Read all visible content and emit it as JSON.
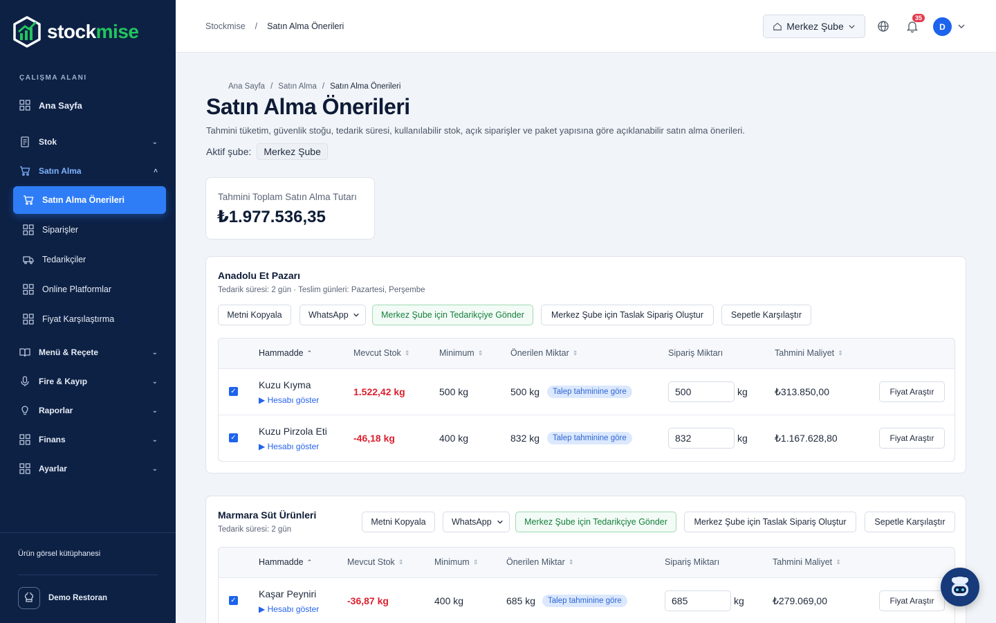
{
  "brand": {
    "name_a": "stock",
    "name_b": "mise"
  },
  "sidebar": {
    "workspace_label": "ÇALIŞMA ALANI",
    "home": "Ana Sayfa",
    "stock": "Stok",
    "purchasing": "Satın Alma",
    "sub": {
      "suggestions": "Satın Alma Önerileri",
      "orders": "Siparişler",
      "suppliers": "Tedarikçiler",
      "platforms": "Online Platformlar",
      "price_compare": "Fiyat Karşılaştırma"
    },
    "menu_recipe": "Menü & Reçete",
    "waste": "Fire & Kayıp",
    "reports": "Raporlar",
    "finance": "Finans",
    "settings": "Ayarlar",
    "image_library": "Ürün görsel kütüphanesi",
    "restaurant": "Demo Restoran"
  },
  "topbar": {
    "crumb_root": "Stockmise",
    "crumb_sep": "/",
    "crumb_current": "Satın Alma Önerileri",
    "branch": "Merkez Şube",
    "notifications": "35",
    "avatar": "D"
  },
  "page": {
    "crumbs": [
      "Ana Sayfa",
      "/",
      "Satın Alma",
      "/",
      "Satın Alma Önerileri"
    ],
    "title": "Satın Alma Önerileri",
    "description": "Tahmini tüketim, güvenlik stoğu, tedarik süresi, kullanılabilir stok, açık siparişler ve paket yapısına göre açıklanabilir satın alma önerileri.",
    "active_branch_label": "Aktif şube:",
    "active_branch": "Merkez Şube",
    "total_label": "Tahmini Toplam Satın Alma Tutarı",
    "total_value": "₺1.977.536,35"
  },
  "actions": {
    "copy": "Metni Kopyala",
    "channel": "WhatsApp",
    "send": "Merkez Şube için Tedarikçiye Gönder",
    "draft": "Merkez Şube için Taslak Sipariş Oluştur",
    "compare": "Sepetle Karşılaştır"
  },
  "columns": {
    "material": "Hammadde",
    "stock": "Mevcut Stok",
    "minimum": "Minimum",
    "suggested": "Önerilen Miktar",
    "order_qty": "Sipariş Miktarı",
    "est_cost": "Tahmini Maliyet"
  },
  "row_common": {
    "show_calc": "▶ Hesabı göster",
    "reason": "Talep tahminine göre",
    "research": "Fiyat Araştır"
  },
  "suppliers": [
    {
      "name": "Anadolu Et Pazarı",
      "meta": "Tedarik süresi: 2 gün · Teslim günleri: Pazartesi, Perşembe",
      "rows": [
        {
          "name": "Kuzu Kıyma",
          "stock": "1.522,42 kg",
          "minimum": "500 kg",
          "suggested": "500 kg",
          "order": "500",
          "unit": "kg",
          "cost": "₺313.850,00",
          "checked": true
        },
        {
          "name": "Kuzu Pirzola Eti",
          "stock": "-46,18 kg",
          "minimum": "400 kg",
          "suggested": "832 kg",
          "order": "832",
          "unit": "kg",
          "cost": "₺1.167.628,80",
          "checked": true
        }
      ]
    },
    {
      "name": "Marmara Süt Ürünleri",
      "meta": "Tedarik süresi: 2 gün",
      "rows": [
        {
          "name": "Kaşar Peyniri",
          "stock": "-36,87 kg",
          "minimum": "400 kg",
          "suggested": "685 kg",
          "order": "685",
          "unit": "kg",
          "cost": "₺279.069,00",
          "checked": true
        }
      ]
    }
  ],
  "colors": {
    "sidebar": "#0d2145",
    "accent": "#2f7df6",
    "danger": "#dc1f2e",
    "success": "#15803d"
  }
}
